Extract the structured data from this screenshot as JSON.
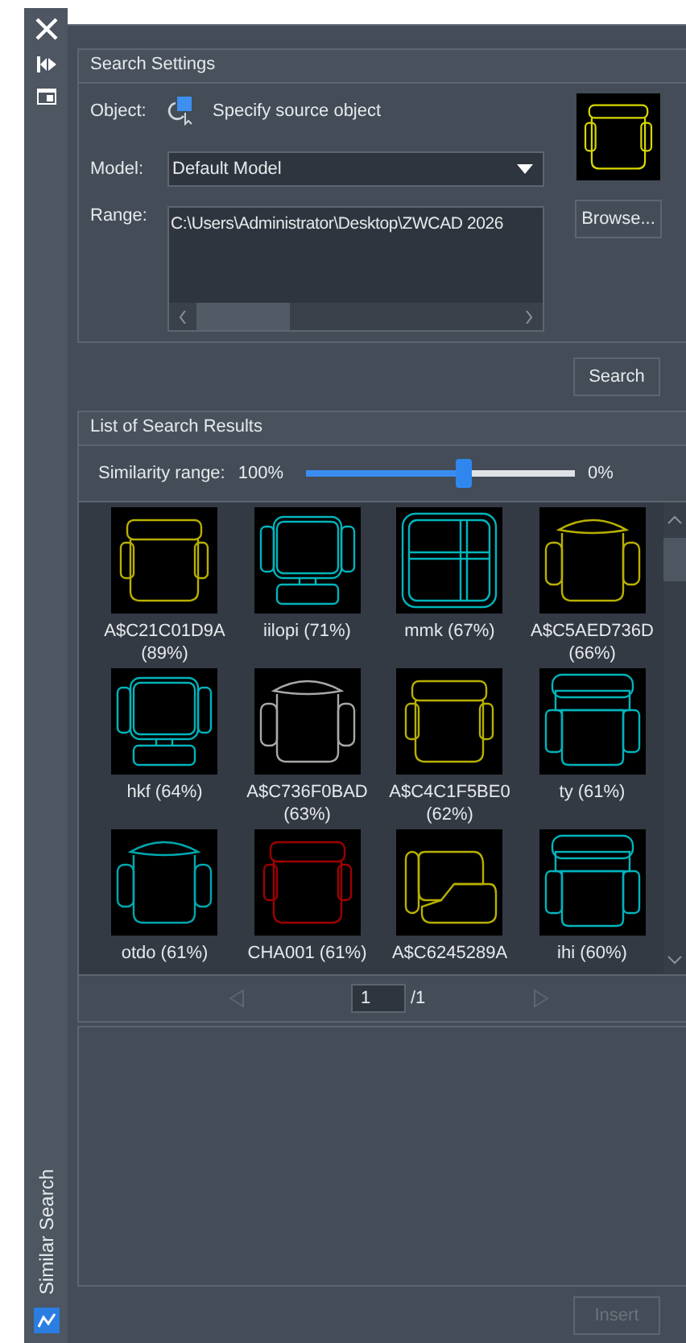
{
  "sidebar": {
    "tab_label": "Similar Search"
  },
  "search_settings": {
    "title": "Search Settings",
    "object_label": "Object:",
    "object_prompt": "Specify source object",
    "preview": {
      "kind": "armchair",
      "color": "#d8d800"
    },
    "model_label": "Model:",
    "model_value": "Default Model",
    "range_label": "Range:",
    "range_value": "C:\\Users\\Administrator\\Desktop\\ZWCAD 2026",
    "browse_button": "Browse..."
  },
  "search_button": "Search",
  "results": {
    "title": "List of Search Results",
    "similarity_label": "Similarity range:",
    "similarity_max": "100%",
    "similarity_min": "0%",
    "similarity": {
      "level": 0.59
    },
    "items": [
      {
        "name": "A$C21C01D9A (89%)",
        "kind": "armchair",
        "color": "#b8b000"
      },
      {
        "name": "iilopi (71%)",
        "kind": "office",
        "color": "#00b4bc"
      },
      {
        "name": "mmk (67%)",
        "kind": "grid",
        "color": "#00b4bc"
      },
      {
        "name": "A$C5AED736D (66%)",
        "kind": "round",
        "color": "#b8b000"
      },
      {
        "name": "hkf (64%)",
        "kind": "office",
        "color": "#00b4bc"
      },
      {
        "name": "A$C736F0BAD (63%)",
        "kind": "round",
        "color": "#a8a8a8"
      },
      {
        "name": "A$C4C1F5BE0 (62%)",
        "kind": "armchair",
        "color": "#b8b000"
      },
      {
        "name": "ty (61%)",
        "kind": "sofa",
        "color": "#00b4bc"
      },
      {
        "name": "otdo (61%)",
        "kind": "round",
        "color": "#00a8b0"
      },
      {
        "name": "CHA001 (61%)",
        "kind": "armchair",
        "color": "#a00000"
      },
      {
        "name": "A$C6245289A",
        "kind": "lounge",
        "color": "#b8b000"
      },
      {
        "name": "ihi (60%)",
        "kind": "sofa",
        "color": "#00b4bc"
      }
    ],
    "page_value": "1",
    "page_total": "/1"
  },
  "insert_button": {
    "label": "Insert",
    "disabled": true
  }
}
